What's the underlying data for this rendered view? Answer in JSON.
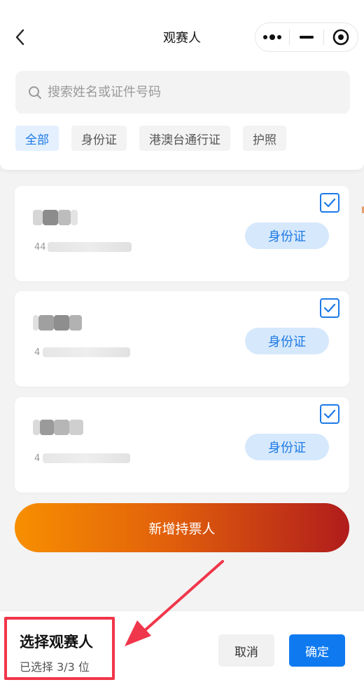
{
  "nav": {
    "title": "观赛人",
    "back_icon": "chevron-left-icon",
    "capsule_icons": [
      "more-dots-icon",
      "minimize-icon",
      "record-target-icon"
    ]
  },
  "search": {
    "placeholder": "搜索姓名或证件号码",
    "value": ""
  },
  "filter_tabs": [
    {
      "label": "全部",
      "active": true
    },
    {
      "label": "身份证",
      "active": false
    },
    {
      "label": "港澳台通行证",
      "active": false
    },
    {
      "label": "护照",
      "active": false
    }
  ],
  "spectators": [
    {
      "name": "",
      "id_prefix": "44",
      "doc_type": "身份证",
      "checked": true
    },
    {
      "name": "",
      "id_prefix": "4",
      "doc_type": "身份证",
      "checked": true
    },
    {
      "name": "",
      "id_prefix": "4",
      "doc_type": "身份证",
      "checked": true
    }
  ],
  "add_button": {
    "label": "新增持票人"
  },
  "footer": {
    "title": "选择观赛人",
    "selected_text": "已选择 3/3 位",
    "cancel_label": "取消",
    "confirm_label": "确定"
  },
  "colors": {
    "accent_blue": "#1c7ae6",
    "confirm_blue": "#0f7af0",
    "gradient_start": "#f78f00",
    "gradient_end": "#b01c1c",
    "annotation_red": "#f0364a"
  }
}
